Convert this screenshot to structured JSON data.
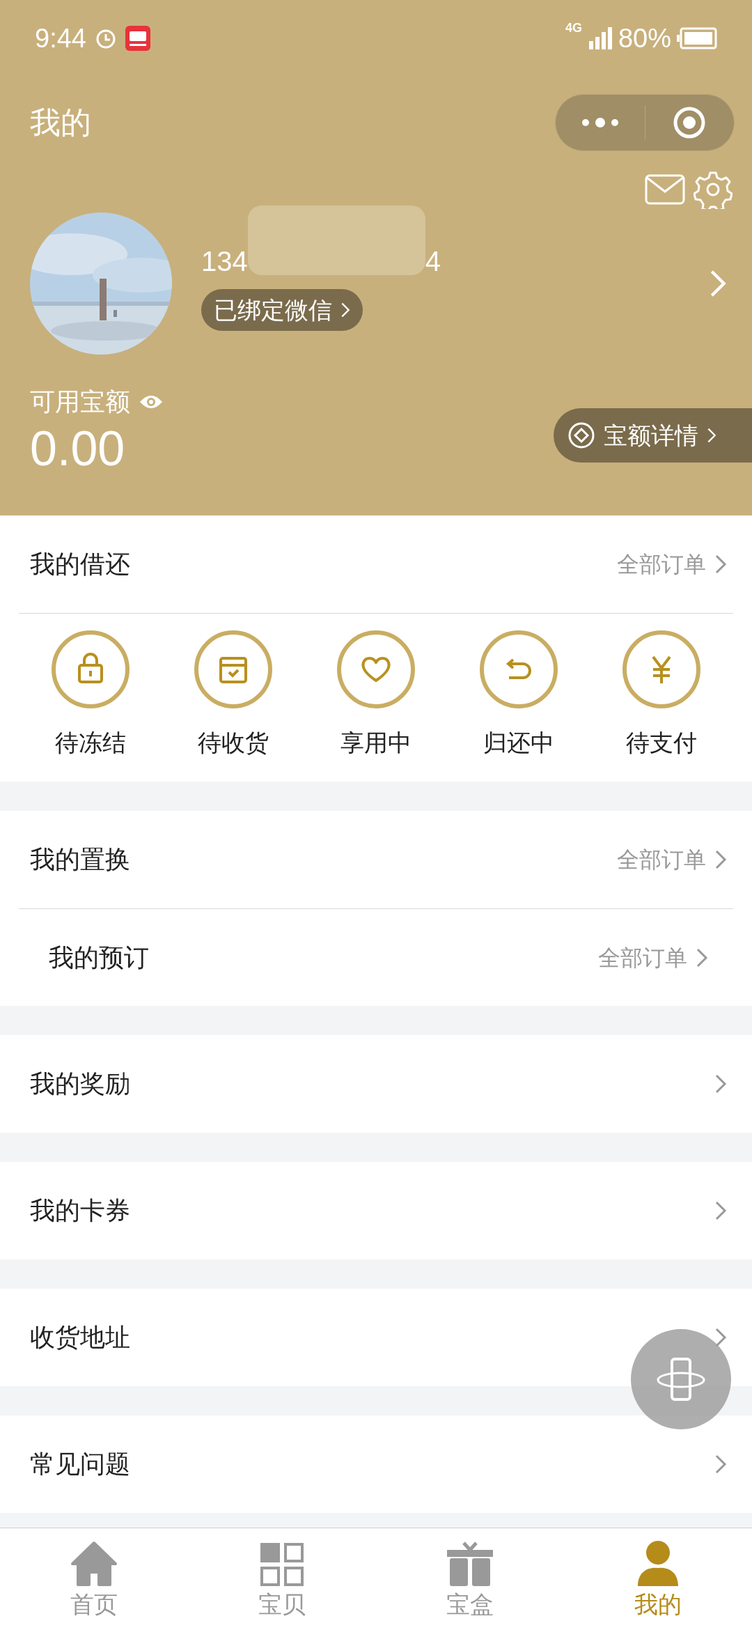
{
  "status_bar": {
    "time": "9:44",
    "network": "4G",
    "battery": "80%"
  },
  "header": {
    "title": "我的",
    "user": {
      "phone_start": "134",
      "phone_end": "4",
      "wechat_badge": "已绑定微信"
    },
    "balance": {
      "label": "可用宝额",
      "amount": "0.00",
      "details_button": "宝额详情"
    }
  },
  "groups": [
    {
      "rows": [
        {
          "title": "我的借还",
          "link": "全部订单"
        }
      ],
      "order_statuses": [
        {
          "kind": "lock",
          "label": "待冻结"
        },
        {
          "kind": "box",
          "label": "待收货"
        },
        {
          "kind": "heart",
          "label": "享用中"
        },
        {
          "kind": "return",
          "label": "归还中"
        },
        {
          "kind": "yen",
          "label": "待支付"
        }
      ]
    },
    {
      "rows": [
        {
          "title": "我的置换",
          "link": "全部订单"
        },
        {
          "title": "我的预订",
          "link": "全部订单"
        }
      ]
    },
    {
      "rows": [
        {
          "title": "我的奖励"
        }
      ]
    },
    {
      "rows": [
        {
          "title": "我的卡券"
        }
      ]
    },
    {
      "rows": [
        {
          "title": "收货地址"
        }
      ]
    },
    {
      "rows": [
        {
          "title": "常见问题"
        }
      ]
    }
  ],
  "tab_bar": [
    {
      "kind": "home",
      "label": "首页",
      "selected": false
    },
    {
      "kind": "grid",
      "label": "宝贝",
      "selected": false
    },
    {
      "kind": "gift",
      "label": "宝盒",
      "selected": false
    },
    {
      "kind": "person",
      "label": "我的",
      "selected": true
    }
  ]
}
